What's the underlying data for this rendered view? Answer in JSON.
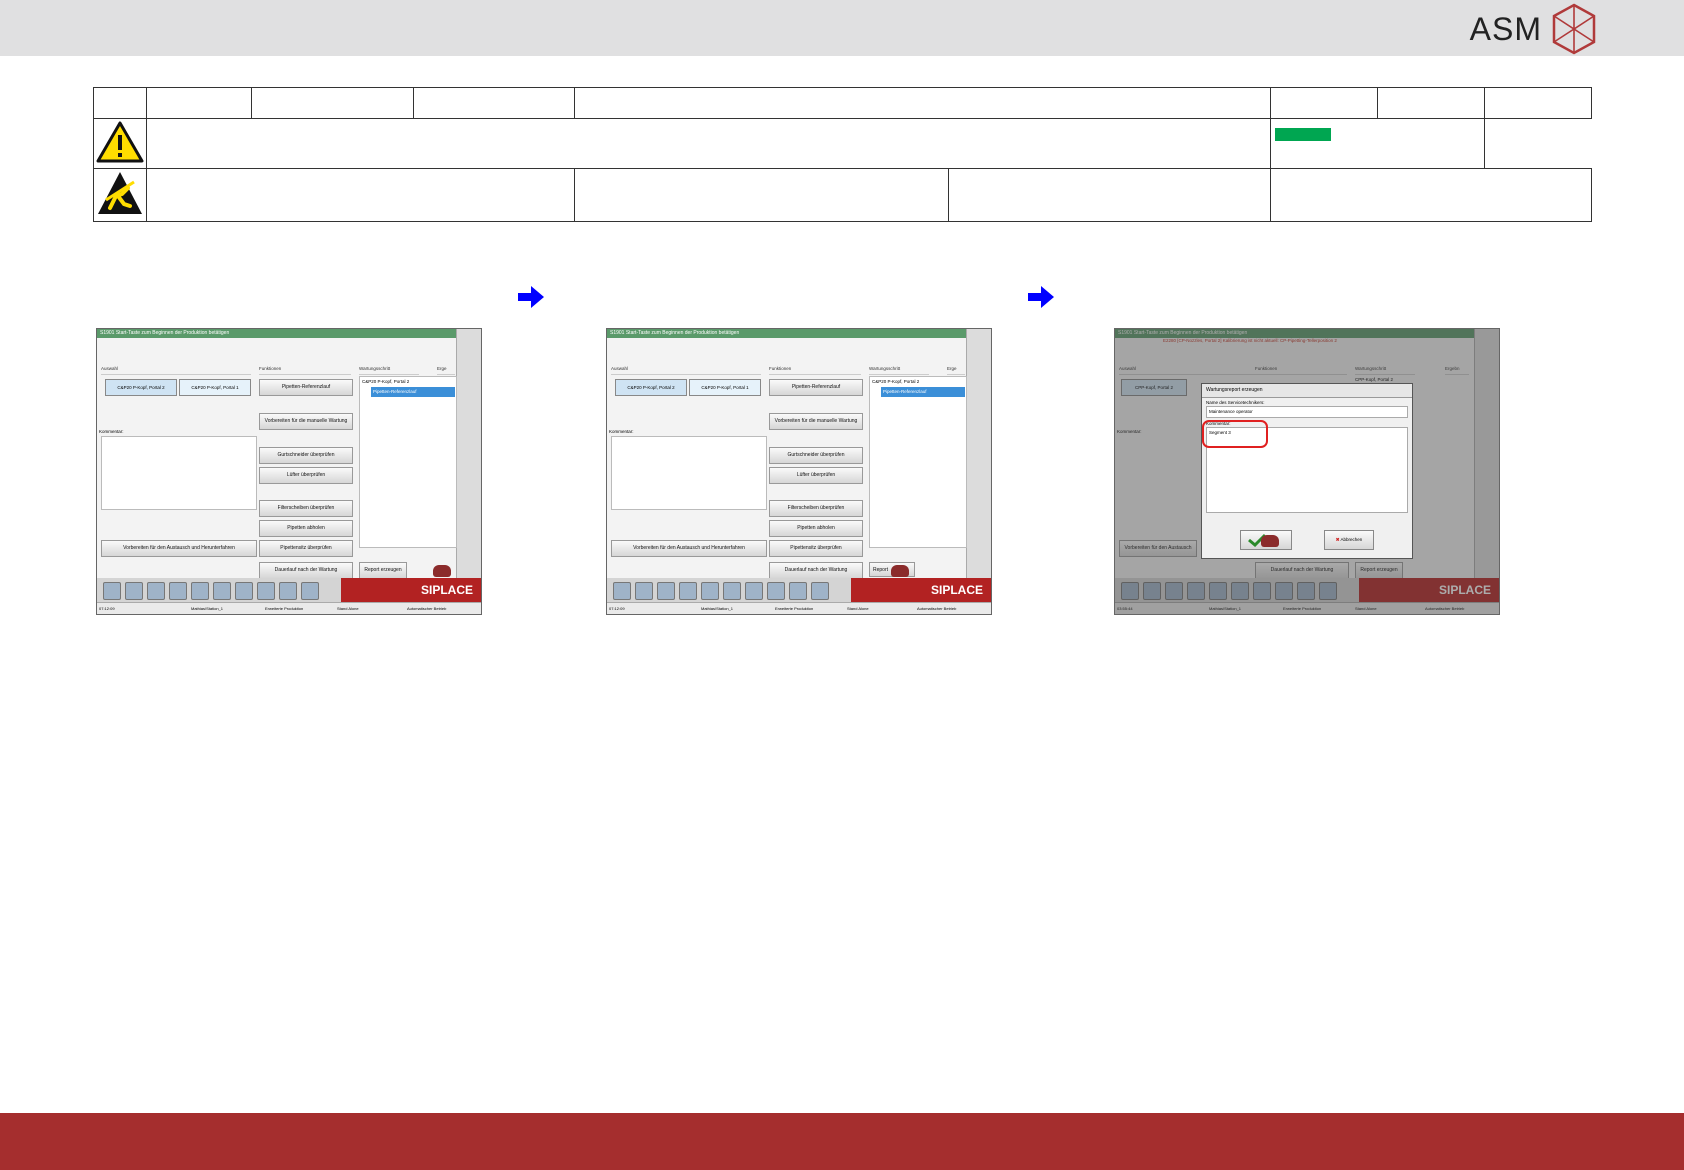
{
  "header": {
    "logo_text": "ASM"
  },
  "colors": {
    "accent_red": "#a52e2e",
    "status_green": "#00a651",
    "status_yellow": "#ffff00",
    "arrow_blue": "#0000ff"
  },
  "screens": [
    {
      "title": "S1901 Start-Taste zum Beginnen der Produktion betätigen",
      "col_auswahl": "Auswahl",
      "col_funktionen": "Funktionen",
      "col_wartung": "Wartungsschritt",
      "col_ergebnis": "Erge",
      "sel1": "C&P20 P-Kopf, Portal 2",
      "sel2": "C&P20 P-Kopf, Portal 1",
      "kommentar": "Kommentar:",
      "buttons": [
        "Pipetten-Referenzlauf",
        "Vorbereiten für die manuelle Wartung",
        "Gurtschneider überprüfen",
        "Lüfter überprüfen",
        "Filterscheiben überprüfen",
        "Pipetten abholen",
        "Pipettensitz überprüfen",
        "Dauerlauf nach der Wartung",
        "Report erzeugen"
      ],
      "wide_button": "Vorbereiten für den Austausch und Herunterfahren",
      "list_head": "C&P20 P-Kopf, Portal 2",
      "list_selected": "Pipetten-Referenzlauf",
      "brand": "SIPLACE",
      "status": [
        "07:12:09",
        "Mathias\\Station_1",
        "Erweiterte Produktion",
        "Stand Alone",
        "Automatischer Betrieb"
      ]
    },
    {
      "title": "S1901 Start-Taste zum Beginnen der Produktion betätigen",
      "col_auswahl": "Auswahl",
      "col_funktionen": "Funktionen",
      "col_wartung": "Wartungsschritt",
      "col_ergebnis": "Erge",
      "sel1": "C&P20 P-Kopf, Portal 2",
      "sel2": "C&P20 P-Kopf, Portal 1",
      "kommentar": "Kommentar:",
      "buttons": [
        "Pipetten-Referenzlauf",
        "Vorbereiten für die manuelle Wartung",
        "Gurtschneider überprüfen",
        "Lüfter überprüfen",
        "Filterscheiben überprüfen",
        "Pipetten abholen",
        "Pipettensitz überprüfen",
        "Dauerlauf nach der Wartung",
        "Report"
      ],
      "wide_button": "Vorbereiten für den Austausch und Herunterfahren",
      "list_head": "C&P20 P-Kopf, Portal 2",
      "list_selected": "Pipetten-Referenzlauf",
      "brand": "SIPLACE",
      "status": [
        "07:12:09",
        "Mathias\\Station_1",
        "Erweiterte Produktion",
        "Stand Alone",
        "Automatischer Betrieb"
      ]
    },
    {
      "title": "S1901 Start-Taste zum Beginnen der Produktion betätigen",
      "warning": "E2280 [CP-Nozzles, Portal 2] Kalibrierung ist nicht aktuell: CP-Pipetting-Tellerposition 2",
      "col_auswahl": "Auswahl",
      "col_funktionen": "Funktionen",
      "col_wartung": "Wartungsschritt",
      "col_ergebnis": "Ergebn",
      "sel1": "CPP-Kopf, Portal 2",
      "list_head": "CPP-Kopf, Portal 2",
      "kommentar": "Kommentar:",
      "wide_button": "Vorbereiten für den Austausch",
      "buttons": [
        "Dauerlauf nach der Wartung",
        "Report erzeugen"
      ],
      "dialog": {
        "title": "Wartungsreport erzeugen",
        "name_label": "Name des Servicetechnikers:",
        "name_value": "Maintenance operator",
        "comment_label": "Kommentar:",
        "comment_value": "Segment 3",
        "cancel": "Abbrechen"
      },
      "brand": "SIPLACE",
      "status": [
        "03:55:44",
        "Mathias\\Station_1",
        "Erweiterte Produktion",
        "Stand Alone",
        "Automatischer Betrieb"
      ]
    }
  ]
}
